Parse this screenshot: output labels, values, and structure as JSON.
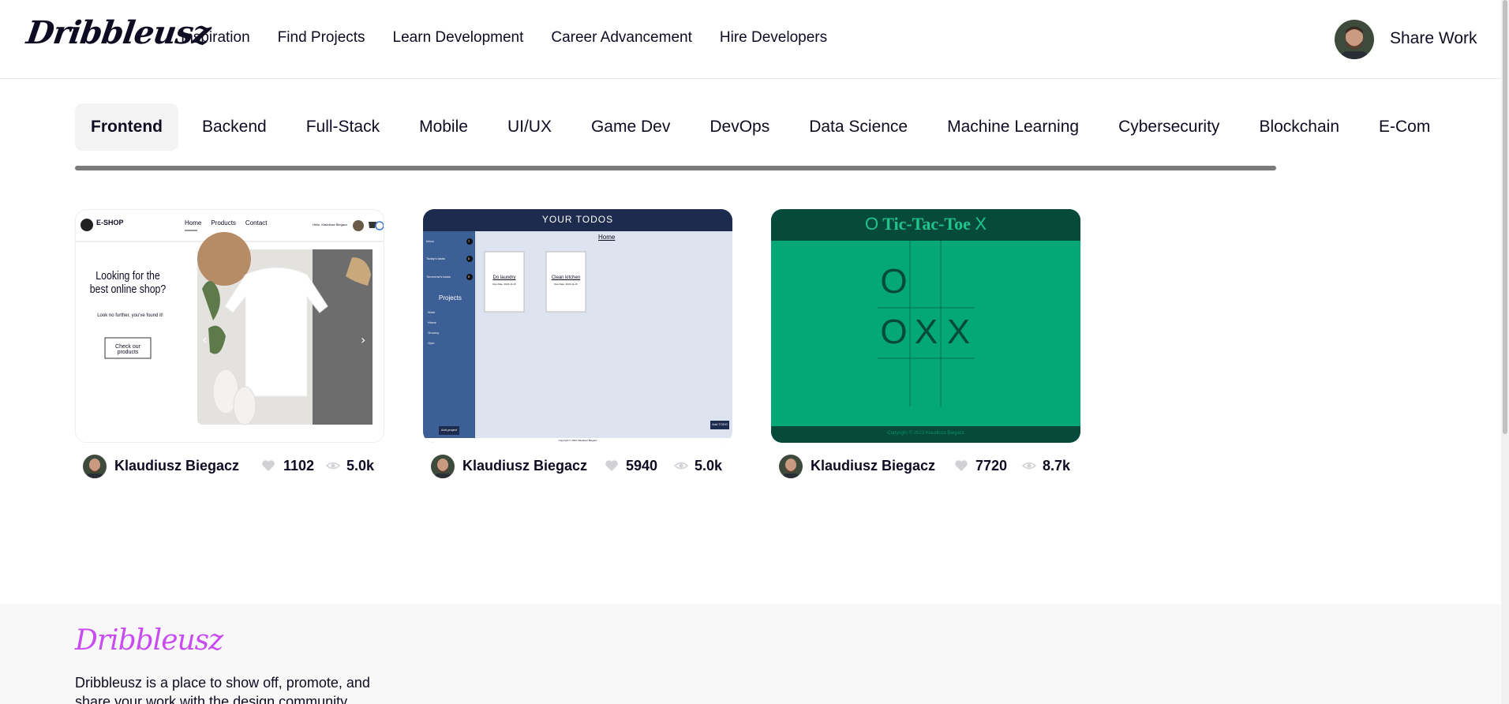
{
  "header": {
    "logo": "Dribbleusz",
    "nav": [
      "Inspiration",
      "Find Projects",
      "Learn Development",
      "Career Advancement",
      "Hire Developers"
    ],
    "share_label": "Share Work"
  },
  "tabs": [
    "Frontend",
    "Backend",
    "Full-Stack",
    "Mobile",
    "UI/UX",
    "Game Dev",
    "DevOps",
    "Data Science",
    "Machine Learning",
    "Cybersecurity",
    "Blockchain",
    "E-Com"
  ],
  "active_tab": "Frontend",
  "cards": [
    {
      "author": "Klaudiusz Biegacz",
      "likes": "1102",
      "views": "5.0k",
      "shot": {
        "brand": "E-SHOP",
        "nav": [
          "Home",
          "Products",
          "Contact"
        ],
        "greeting": "Hello, Klaudiusz Biegacz",
        "headline": "Looking for the best online shop?",
        "sub": "Look no further, you've found it!",
        "cta": "Check our products"
      }
    },
    {
      "author": "Klaudiusz Biegacz",
      "likes": "5940",
      "views": "5.0k",
      "shot": {
        "title": "YOUR TODOS",
        "home": "Home",
        "sidebar": [
          {
            "label": "Inbox",
            "count": "7"
          },
          {
            "label": "Today's tasks",
            "count": "0"
          },
          {
            "label": "Tomorrow's tasks",
            "count": "0"
          }
        ],
        "projects_heading": "Projects",
        "projects": [
          "Work",
          "Home",
          "Grocery",
          "Gym"
        ],
        "todos": [
          {
            "title": "Do laundry",
            "date": "Due Date: 2023-11-15"
          },
          {
            "title": "Clean kitchen",
            "date": "Due Date: 2023-11-16"
          }
        ],
        "add_project": "Add project",
        "add_todo": "Add TODO",
        "copyright": "Copyright © 2023 Klaudiusz Biegacz"
      }
    },
    {
      "author": "Klaudiusz Biegacz",
      "likes": "7720",
      "views": "8.7k",
      "shot": {
        "title": "Tic-Tac-Toe",
        "title_left_glyph": "O",
        "title_right_glyph": "X",
        "board": [
          "O",
          "",
          "",
          "O",
          "X",
          "X",
          "",
          "",
          ""
        ],
        "footer": "Copyright © 2023 Klaudiusz Biegacz"
      }
    }
  ],
  "footer": {
    "logo": "Dribbleusz",
    "text": "Dribbleusz is a place to show off, promote, and share your work with the design community."
  }
}
